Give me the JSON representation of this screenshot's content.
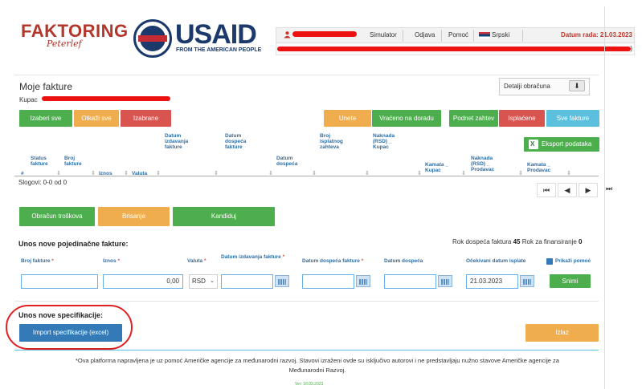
{
  "brand": {
    "faktoring": "FAKTORING",
    "faktoring_sub": "Peterlef",
    "usaid": "USAID",
    "usaid_sub": "FROM THE AMERICAN PEOPLE"
  },
  "topbar": {
    "simulator": "Simulator",
    "odjava": "Odjava",
    "pomoc": "Pomoć",
    "language": "Srpski",
    "date_label": "Datum rada: 21.03.2023",
    "subbar_tail": ")"
  },
  "page": {
    "title": "Moje fakture",
    "kupac_label": "Kupac",
    "detalji_label": "Detalji obračuna",
    "detalji_icon": "arrow-down-icon"
  },
  "actions": {
    "izaberi_sve": "Izaberi sve",
    "otkazi_sve": "Otkaži sve",
    "izabrane": "Izabrane"
  },
  "filters": {
    "unete": "Unete",
    "vraceno": "Vraćeno na doradu",
    "podnet": "Podnet zahtev",
    "isplacene": "Isplaćene",
    "sve": "Sve fakture"
  },
  "export_label": "Eksport podataka",
  "table": {
    "columns": [
      {
        "label": "#"
      },
      {
        "label": "Status fakture"
      },
      {
        "label": "Broj fakture"
      },
      {
        "label": "Iznos"
      },
      {
        "label": "Valuta"
      },
      {
        "label": "Datum izdavanja fakture"
      },
      {
        "label": "Datum dospeća fakture"
      },
      {
        "label": "Datum dospeća"
      },
      {
        "label": "Broj isplatnog zahteva"
      },
      {
        "label": "Naknada (RSD) _ Kupac"
      },
      {
        "label": "Kamata _ Kupac"
      },
      {
        "label": "Naknada (RSD) _ Prodavac"
      },
      {
        "label": "Kamata _ Prodavac"
      }
    ],
    "records_label": "Slogovi: 0-0 od 0"
  },
  "row_actions": {
    "obracun": "Obračun troškova",
    "brisanje": "Brisanje",
    "kandiduj": "Kandiduj"
  },
  "new_invoice": {
    "title": "Unos nove pojedinačne fakture:",
    "rok_label_1": "Rok dospeća faktura",
    "rok_value_1": "45",
    "rok_label_2": "Rok za finansiranje",
    "rok_value_2": "0",
    "labels": {
      "broj": "Broj fakture",
      "iznos": "Iznos",
      "valuta": "Valuta",
      "datum_izdavanja": "Datum izdavanja fakture",
      "datum_dospeca_fakture": "Datum dospeća fakture",
      "datum_dospeca": "Datum dospeća",
      "ocekivani": "Očekivani datum isplate",
      "prikazi": "Prikaži pomoć"
    },
    "values": {
      "broj": "",
      "iznos": "0,00",
      "valuta": "RSD",
      "datum_izdavanja": "",
      "datum_dospeca_fakture": "",
      "datum_dospeca": "",
      "ocekivani": "21.03.2023"
    },
    "snimi": "Snimi"
  },
  "specification": {
    "title": "Unos nove specifikacije:",
    "import_label": "Import specifikacije (excel)",
    "izlaz": "Izlaz"
  },
  "footer": {
    "text": "*Ova platforma napravljena je uz pomoć Američke agencije za međunarodni razvoj. Stavovi izraženi ovde su isključivo autorovi i ne predstavljaju nužno stavove Američke agencije za Međunarodni Razvoj.",
    "version": "Ver: 16.03.2023"
  },
  "colors": {
    "green": "#4cae4c",
    "orange": "#f0ad4e",
    "red": "#d9534f",
    "blue": "#5bc0de",
    "dark_blue": "#337ab7",
    "redaction": "#ee1111"
  }
}
